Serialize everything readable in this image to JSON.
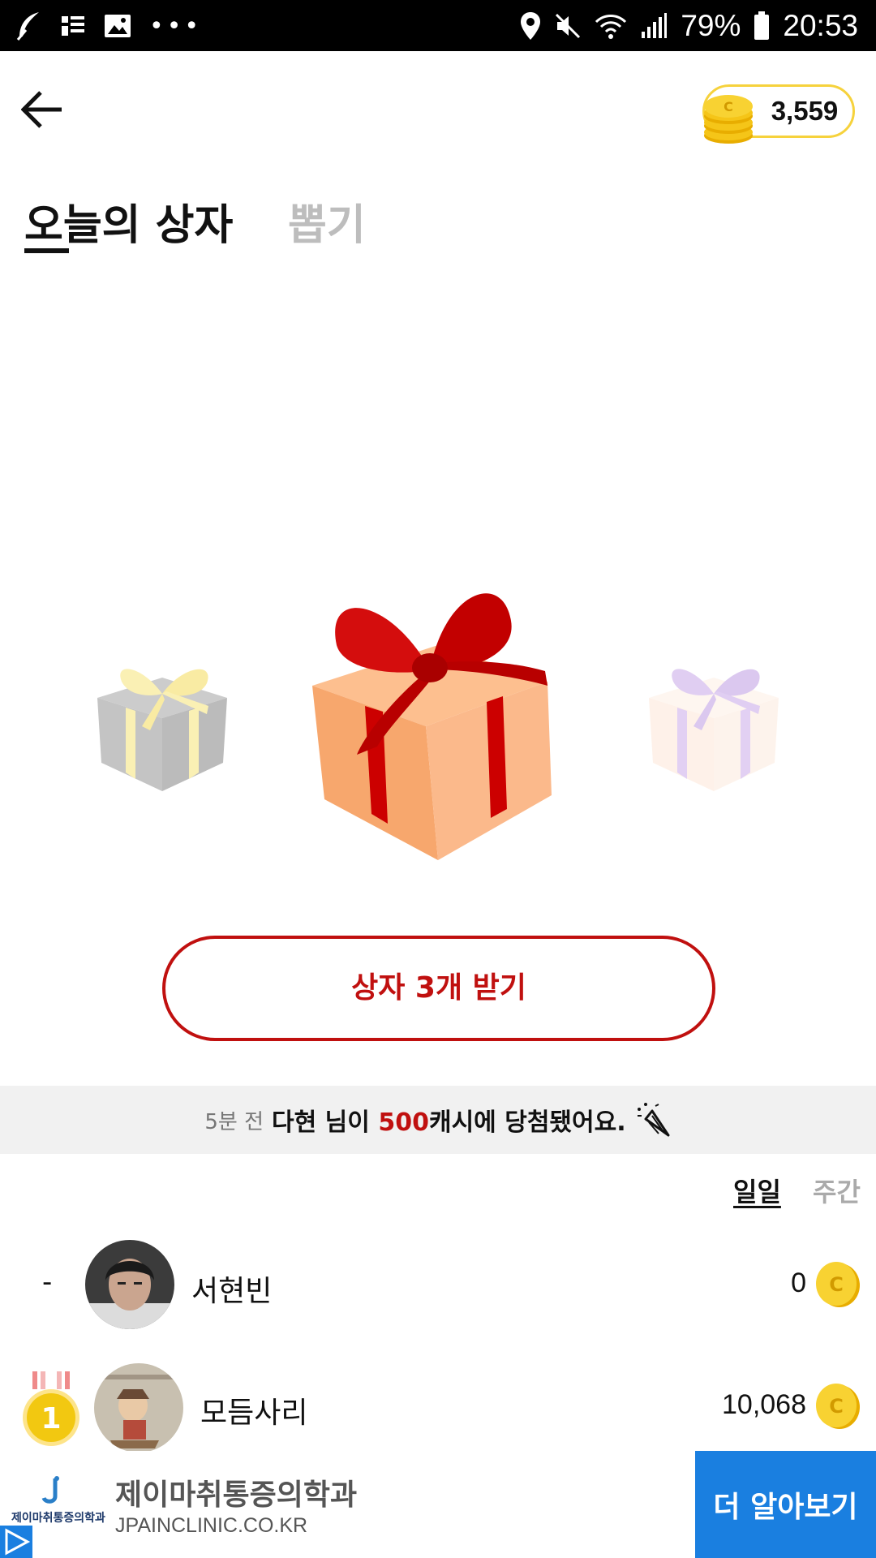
{
  "status_bar": {
    "battery": "79%",
    "time": "20:53",
    "left_icons": [
      "feather-icon",
      "news-icon",
      "image-icon",
      "more-icon"
    ],
    "right_icons": [
      "location-icon",
      "mute-icon",
      "wifi-icon",
      "signal-icon",
      "battery-icon"
    ]
  },
  "header": {
    "back_icon": "back-arrow-icon",
    "coin_balance": "3,559"
  },
  "tabs": {
    "today_box": "오늘의 상자",
    "draw": "뽑기",
    "active": "today_box"
  },
  "gifts": [
    {
      "name": "yellow-ribbon-gift",
      "box_color": "#8a8a8a",
      "ribbon_color": "#f7e26b"
    },
    {
      "name": "red-ribbon-gift",
      "box_color": "#f7a76d",
      "ribbon_color": "#cc0000"
    },
    {
      "name": "purple-ribbon-gift",
      "box_color": "#fde2d0",
      "ribbon_color": "#b98fe0"
    }
  ],
  "receive_button": "상자 3개 받기",
  "notice": {
    "time": "5분 전",
    "user": "다현 님이",
    "amount": "500",
    "suffix": "캐시에 당첨됐어요.",
    "icon": "party-popper-icon"
  },
  "period_tabs": {
    "daily": "일일",
    "weekly": "주간",
    "active": "daily"
  },
  "ranking": [
    {
      "rank": "-",
      "name": "서현빈",
      "score": "0"
    },
    {
      "rank": "1",
      "name": "모듬사리",
      "score": "10,068"
    }
  ],
  "ad": {
    "logo_text": "제이마취통증의학과",
    "title": "제이마취통증의학과",
    "url": "JPAINCLINIC.CO.KR",
    "cta": "더 알아보기"
  },
  "colors": {
    "accent_red": "#c0100f",
    "coin_gold": "#f5c518",
    "ad_blue": "#1a7fe0"
  }
}
